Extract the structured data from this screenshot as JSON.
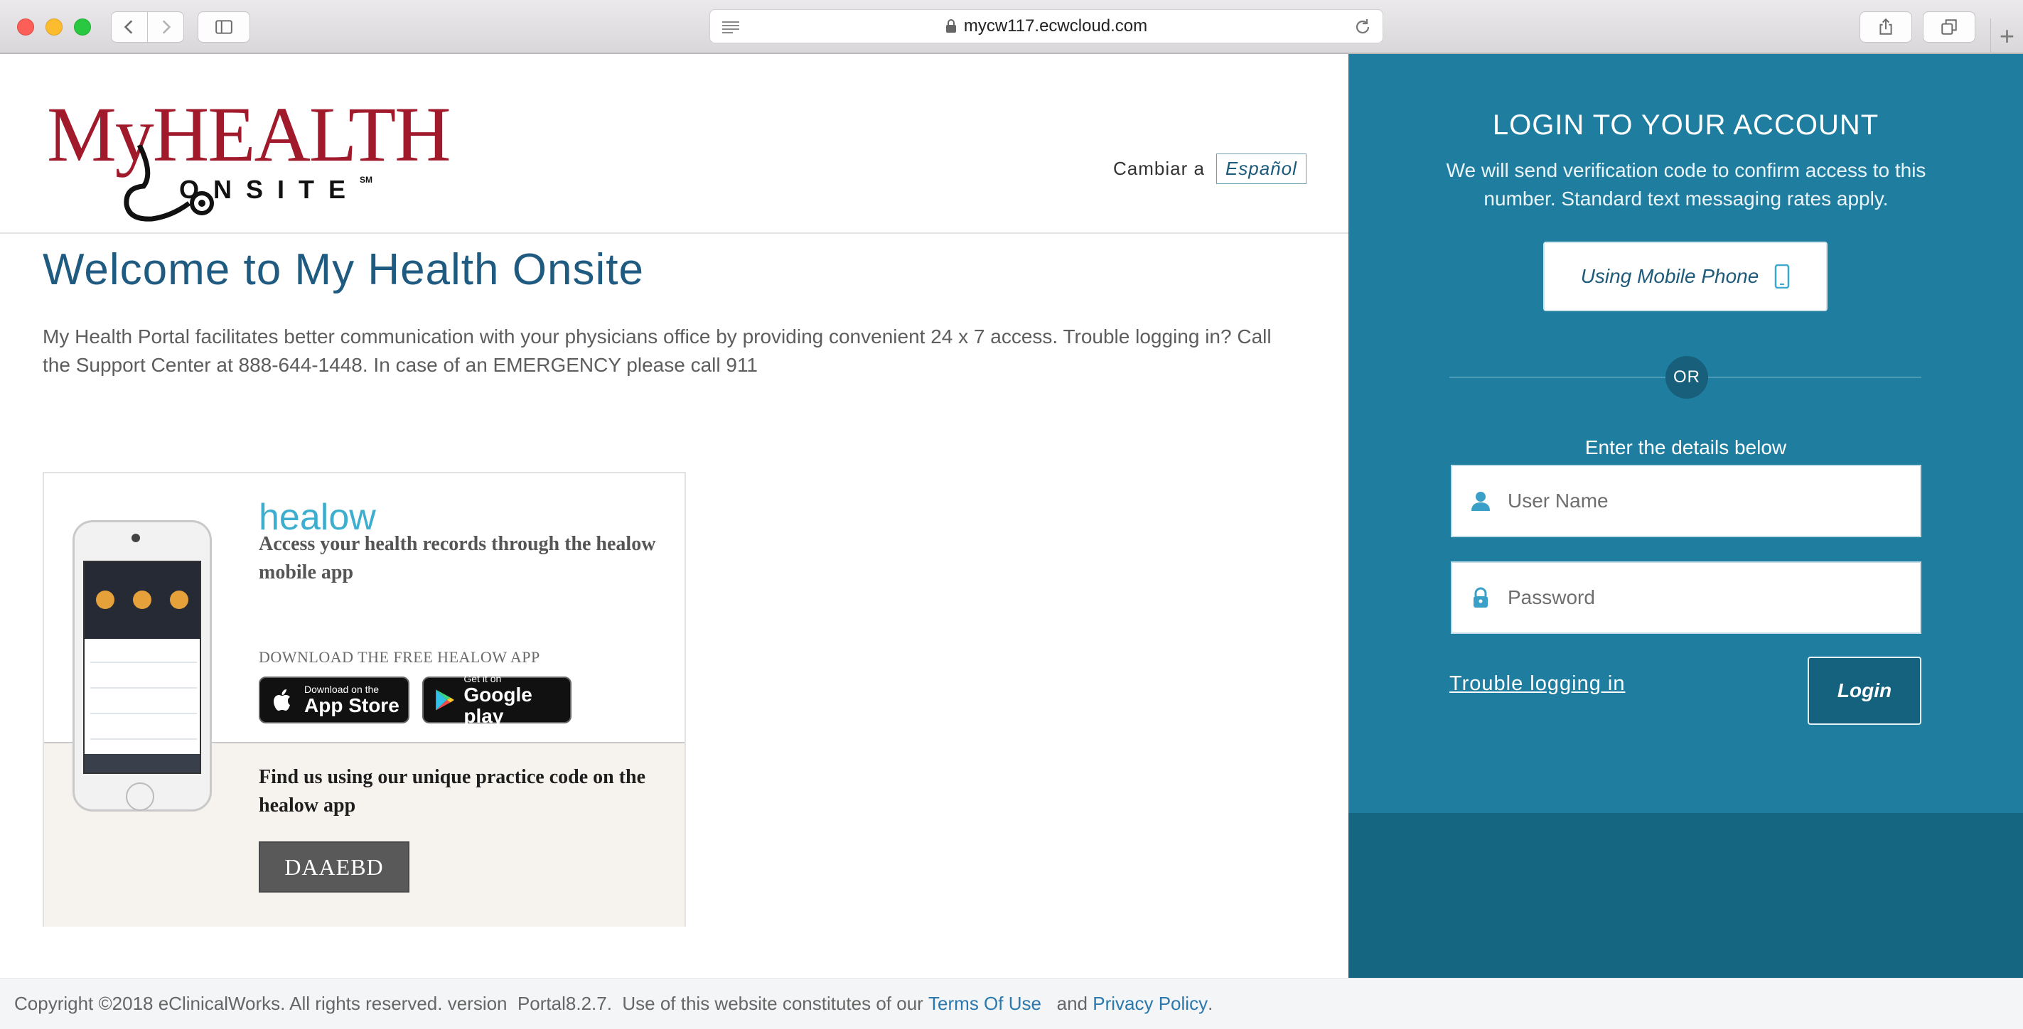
{
  "browser": {
    "url": "mycw117.ecwcloud.com"
  },
  "header": {
    "logo_top": "MyHEALTH",
    "logo_bottom": "ONSITE",
    "logo_sm": "SM",
    "lang_label": "Cambiar a",
    "lang_button": "Español"
  },
  "main": {
    "title": "Welcome to My Health Onsite",
    "intro": "My Health Portal facilitates better communication with your physicians office by providing convenient 24 x 7 access. Trouble logging in? Call the Support Center at 888-644-1448. In case of an EMERGENCY please call 911"
  },
  "healow": {
    "logo": "healow",
    "title": "Access your health records through the healow mobile app",
    "download_label": "DOWNLOAD THE FREE HEALOW APP",
    "appstore_small": "Download on the",
    "appstore_big": "App Store",
    "googleplay_small": "Get it on",
    "googleplay_big": "Google play",
    "practice_text": "Find us using our unique practice code on the healow app",
    "practice_code": "DAAEBD"
  },
  "login": {
    "title": "LOGIN TO YOUR ACCOUNT",
    "description": "We will send verification code to confirm access to this number. Standard text messaging rates apply.",
    "mobile_button": "Using Mobile Phone",
    "or": "OR",
    "enter_label": "Enter the details below",
    "username_placeholder": "User Name",
    "password_placeholder": "Password",
    "trouble_link": "Trouble logging in",
    "login_button": "Login"
  },
  "footer": {
    "copyright": "Copyright ©2018 eClinicalWorks. All rights reserved. version  Portal8.2.7.  Use of this website constitutes of our ",
    "terms": "Terms Of Use",
    "and": "   and ",
    "privacy": "Privacy Policy",
    "period": "."
  },
  "colors": {
    "accent": "#1f7ea0",
    "accent_dark": "#156681",
    "brand_red": "#a11a2c",
    "title_blue": "#1f5a80"
  }
}
